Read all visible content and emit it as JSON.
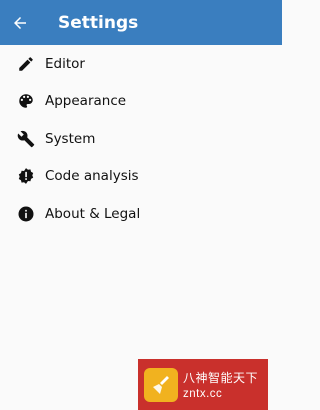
{
  "appbar": {
    "title": "Settings",
    "back_icon": "arrow-back-icon",
    "color": "#3a7ebf"
  },
  "items": [
    {
      "label": "Editor",
      "icon": "pencil-icon"
    },
    {
      "label": "Appearance",
      "icon": "palette-icon"
    },
    {
      "label": "System",
      "icon": "wrench-icon"
    },
    {
      "label": "Code analysis",
      "icon": "badge-alert-icon"
    },
    {
      "label": "About & Legal",
      "icon": "info-icon"
    }
  ],
  "watermark": {
    "text": "八神智能天下",
    "url": "zntx.cc",
    "icon": "broom-logo-icon"
  }
}
